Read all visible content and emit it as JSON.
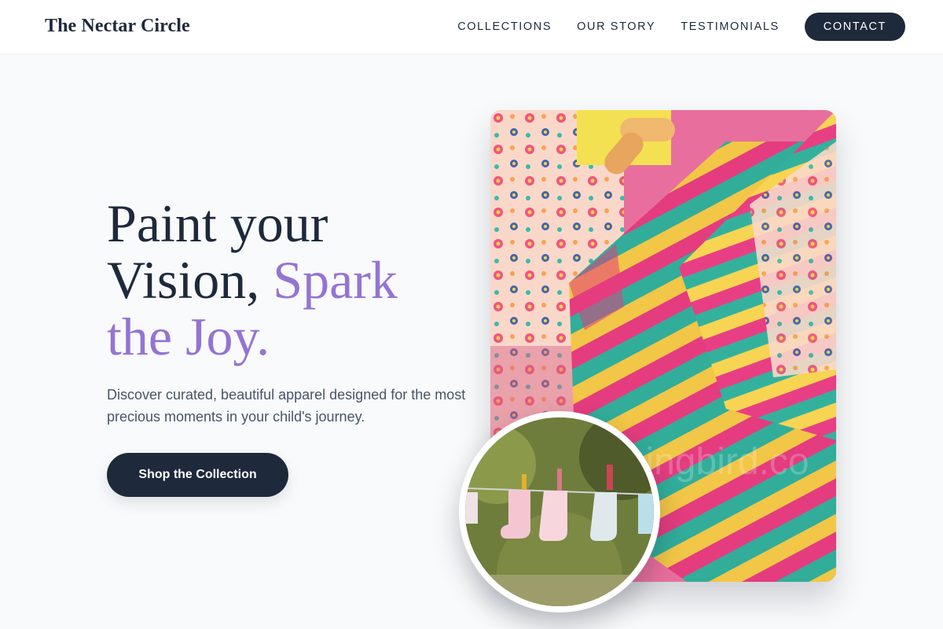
{
  "header": {
    "brand": "The Nectar Circle",
    "nav": [
      {
        "label": "COLLECTIONS"
      },
      {
        "label": "OUR STORY"
      },
      {
        "label": "TESTIMONIALS"
      }
    ],
    "cta_label": "CONTACT"
  },
  "hero": {
    "headline_line1": "Paint your",
    "headline_line2_plain": "Vision,",
    "headline_line2_accent": "Spark",
    "headline_line3_accent": "the Joy.",
    "description": "Discover curated, beautiful apparel designed for the most precious moments in your child's journey.",
    "button_label": "Shop the Collection"
  },
  "images": {
    "main_photo": "colorful-striped-childrens-shirts-on-rack-photo",
    "round_photo": "baby-socks-on-clothesline-photo",
    "watermark": "unnyhummingbird.co"
  },
  "colors": {
    "primary": "#1e293b",
    "accent": "#9474d2",
    "background": "#f9fafb"
  }
}
